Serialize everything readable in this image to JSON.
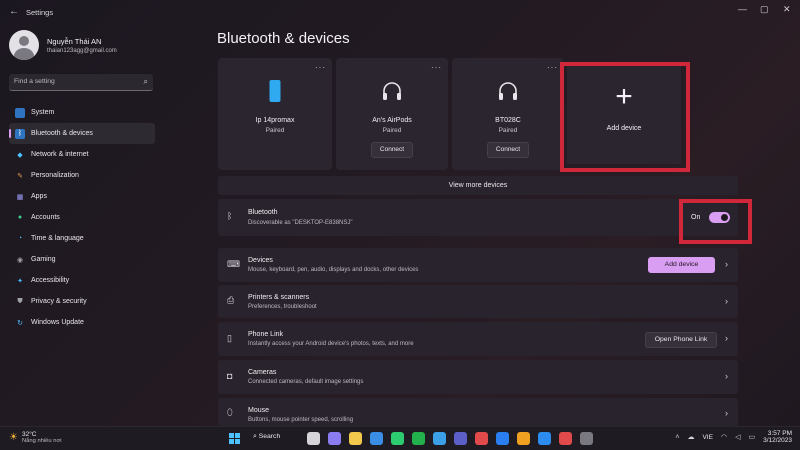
{
  "window": {
    "title": "Settings",
    "back_icon": "←",
    "minimize_icon": "—",
    "maximize_icon": "▢",
    "close_icon": "✕"
  },
  "profile": {
    "name": "Nguyễn Thái AN",
    "email": "thaian123agg@gmail.com"
  },
  "search": {
    "placeholder": "Find a setting",
    "icon": "⌕"
  },
  "sidebar": {
    "items": [
      {
        "label": "System",
        "icon": "▭",
        "color": "#4cc2ff"
      },
      {
        "label": "Bluetooth & devices",
        "icon": "ᛒ",
        "color": "#4cc2ff"
      },
      {
        "label": "Network & internet",
        "icon": "◆",
        "color": "#4cc2ff"
      },
      {
        "label": "Personalization",
        "icon": "✎",
        "color": "#e0a050"
      },
      {
        "label": "Apps",
        "icon": "▦",
        "color": "#a0a0ff"
      },
      {
        "label": "Accounts",
        "icon": "●",
        "color": "#3ecf8e"
      },
      {
        "label": "Time & language",
        "icon": "◔",
        "color": "#4cc2ff"
      },
      {
        "label": "Gaming",
        "icon": "◉",
        "color": "#a0a0a8"
      },
      {
        "label": "Accessibility",
        "icon": "✦",
        "color": "#4cc2ff"
      },
      {
        "label": "Privacy & security",
        "icon": "⛊",
        "color": "#a0a0a8"
      },
      {
        "label": "Windows Update",
        "icon": "↻",
        "color": "#4cc2ff"
      }
    ]
  },
  "main": {
    "title": "Bluetooth & devices",
    "devices": [
      {
        "name": "Ip 14promax",
        "status": "Paired",
        "connect": ""
      },
      {
        "name": "An's AirPods",
        "status": "Paired",
        "connect": "Connect"
      },
      {
        "name": "BT028C",
        "status": "Paired",
        "connect": "Connect"
      }
    ],
    "add_device_card": "Add device",
    "view_more": "View more devices",
    "bluetooth": {
      "title": "Bluetooth",
      "subtitle": "Discoverable as \"DESKTOP-E838NSJ\"",
      "toggle_label": "On",
      "state": true
    },
    "rows": {
      "devices": {
        "title": "Devices",
        "subtitle": "Mouse, keyboard, pen, audio, displays and docks, other devices",
        "button": "Add device"
      },
      "printers": {
        "title": "Printers & scanners",
        "subtitle": "Preferences, troubleshoot"
      },
      "phone": {
        "title": "Phone Link",
        "subtitle": "Instantly access your Android device's photos, texts, and more",
        "button": "Open Phone Link"
      },
      "cameras": {
        "title": "Cameras",
        "subtitle": "Connected cameras, default image settings"
      },
      "mouse": {
        "title": "Mouse",
        "subtitle": "Buttons, mouse pointer speed, scrolling"
      }
    }
  },
  "taskbar": {
    "weather_temp": "32°C",
    "weather_desc": "Nắng nhiều nơi",
    "search_label": "Search",
    "lang": "VIE",
    "time": "3:57 PM",
    "date": "3/12/2023",
    "apps": [
      "#d6d3d9",
      "#8a7cf0",
      "#f2c94c",
      "#3a8ee6",
      "#2ecc71",
      "#22b14c",
      "#3ba0e8",
      "#5b5fc7",
      "#e04a4a",
      "#2a7ff0",
      "#f0a020",
      "#2d8cf0",
      "#e04a4a",
      "#7a7880"
    ]
  }
}
